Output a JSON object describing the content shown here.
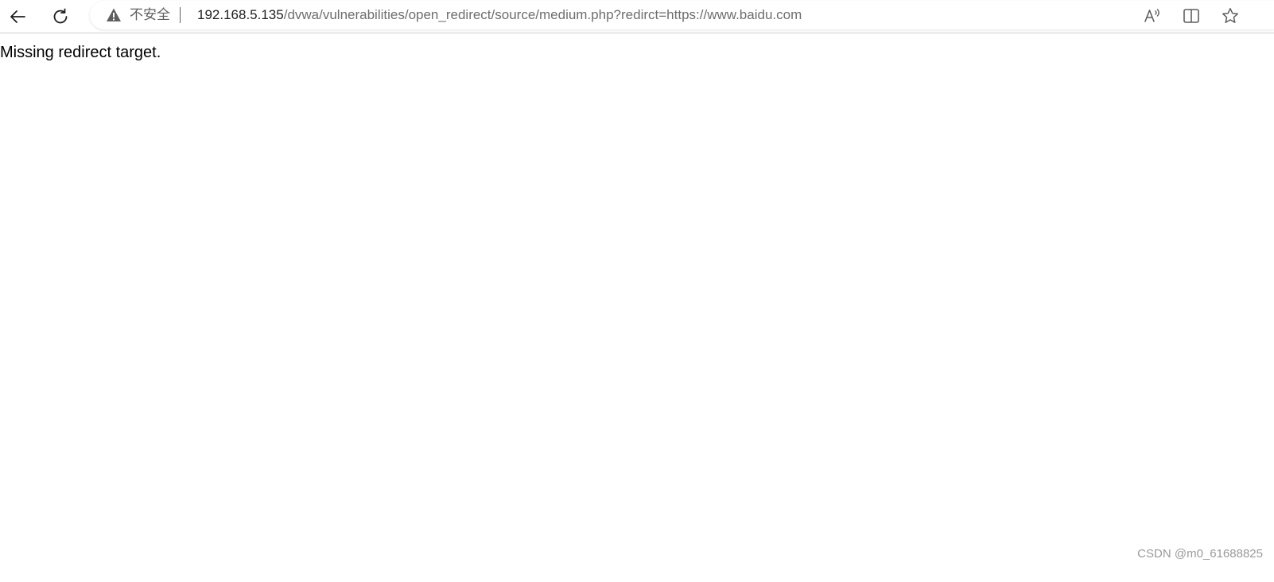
{
  "browser": {
    "security_label": "不安全",
    "url_host": "192.168.5.135",
    "url_path": "/dvwa/vulnerabilities/open_redirect/source/medium.php?redirct=https://www.baidu.com",
    "icons": [
      "back-arrow-icon",
      "reload-icon",
      "warning-icon",
      "read-aloud-icon",
      "split-screen-icon",
      "favorite-star-icon"
    ]
  },
  "page": {
    "message": "Missing redirect target."
  },
  "watermark": "CSDN @m0_61688825"
}
